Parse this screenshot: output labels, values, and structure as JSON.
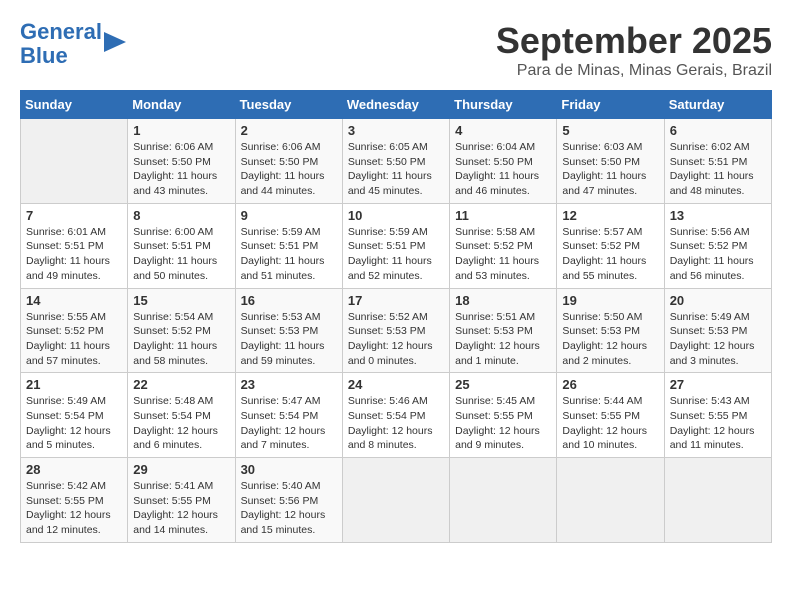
{
  "logo": {
    "line1": "General",
    "line2": "Blue"
  },
  "title": "September 2025",
  "subtitle": "Para de Minas, Minas Gerais, Brazil",
  "days_of_week": [
    "Sunday",
    "Monday",
    "Tuesday",
    "Wednesday",
    "Thursday",
    "Friday",
    "Saturday"
  ],
  "weeks": [
    [
      {
        "day": "",
        "info": ""
      },
      {
        "day": "1",
        "info": "Sunrise: 6:06 AM\nSunset: 5:50 PM\nDaylight: 11 hours\nand 43 minutes."
      },
      {
        "day": "2",
        "info": "Sunrise: 6:06 AM\nSunset: 5:50 PM\nDaylight: 11 hours\nand 44 minutes."
      },
      {
        "day": "3",
        "info": "Sunrise: 6:05 AM\nSunset: 5:50 PM\nDaylight: 11 hours\nand 45 minutes."
      },
      {
        "day": "4",
        "info": "Sunrise: 6:04 AM\nSunset: 5:50 PM\nDaylight: 11 hours\nand 46 minutes."
      },
      {
        "day": "5",
        "info": "Sunrise: 6:03 AM\nSunset: 5:50 PM\nDaylight: 11 hours\nand 47 minutes."
      },
      {
        "day": "6",
        "info": "Sunrise: 6:02 AM\nSunset: 5:51 PM\nDaylight: 11 hours\nand 48 minutes."
      }
    ],
    [
      {
        "day": "7",
        "info": "Sunrise: 6:01 AM\nSunset: 5:51 PM\nDaylight: 11 hours\nand 49 minutes."
      },
      {
        "day": "8",
        "info": "Sunrise: 6:00 AM\nSunset: 5:51 PM\nDaylight: 11 hours\nand 50 minutes."
      },
      {
        "day": "9",
        "info": "Sunrise: 5:59 AM\nSunset: 5:51 PM\nDaylight: 11 hours\nand 51 minutes."
      },
      {
        "day": "10",
        "info": "Sunrise: 5:59 AM\nSunset: 5:51 PM\nDaylight: 11 hours\nand 52 minutes."
      },
      {
        "day": "11",
        "info": "Sunrise: 5:58 AM\nSunset: 5:52 PM\nDaylight: 11 hours\nand 53 minutes."
      },
      {
        "day": "12",
        "info": "Sunrise: 5:57 AM\nSunset: 5:52 PM\nDaylight: 11 hours\nand 55 minutes."
      },
      {
        "day": "13",
        "info": "Sunrise: 5:56 AM\nSunset: 5:52 PM\nDaylight: 11 hours\nand 56 minutes."
      }
    ],
    [
      {
        "day": "14",
        "info": "Sunrise: 5:55 AM\nSunset: 5:52 PM\nDaylight: 11 hours\nand 57 minutes."
      },
      {
        "day": "15",
        "info": "Sunrise: 5:54 AM\nSunset: 5:52 PM\nDaylight: 11 hours\nand 58 minutes."
      },
      {
        "day": "16",
        "info": "Sunrise: 5:53 AM\nSunset: 5:53 PM\nDaylight: 11 hours\nand 59 minutes."
      },
      {
        "day": "17",
        "info": "Sunrise: 5:52 AM\nSunset: 5:53 PM\nDaylight: 12 hours\nand 0 minutes."
      },
      {
        "day": "18",
        "info": "Sunrise: 5:51 AM\nSunset: 5:53 PM\nDaylight: 12 hours\nand 1 minute."
      },
      {
        "day": "19",
        "info": "Sunrise: 5:50 AM\nSunset: 5:53 PM\nDaylight: 12 hours\nand 2 minutes."
      },
      {
        "day": "20",
        "info": "Sunrise: 5:49 AM\nSunset: 5:53 PM\nDaylight: 12 hours\nand 3 minutes."
      }
    ],
    [
      {
        "day": "21",
        "info": "Sunrise: 5:49 AM\nSunset: 5:54 PM\nDaylight: 12 hours\nand 5 minutes."
      },
      {
        "day": "22",
        "info": "Sunrise: 5:48 AM\nSunset: 5:54 PM\nDaylight: 12 hours\nand 6 minutes."
      },
      {
        "day": "23",
        "info": "Sunrise: 5:47 AM\nSunset: 5:54 PM\nDaylight: 12 hours\nand 7 minutes."
      },
      {
        "day": "24",
        "info": "Sunrise: 5:46 AM\nSunset: 5:54 PM\nDaylight: 12 hours\nand 8 minutes."
      },
      {
        "day": "25",
        "info": "Sunrise: 5:45 AM\nSunset: 5:55 PM\nDaylight: 12 hours\nand 9 minutes."
      },
      {
        "day": "26",
        "info": "Sunrise: 5:44 AM\nSunset: 5:55 PM\nDaylight: 12 hours\nand 10 minutes."
      },
      {
        "day": "27",
        "info": "Sunrise: 5:43 AM\nSunset: 5:55 PM\nDaylight: 12 hours\nand 11 minutes."
      }
    ],
    [
      {
        "day": "28",
        "info": "Sunrise: 5:42 AM\nSunset: 5:55 PM\nDaylight: 12 hours\nand 12 minutes."
      },
      {
        "day": "29",
        "info": "Sunrise: 5:41 AM\nSunset: 5:55 PM\nDaylight: 12 hours\nand 14 minutes."
      },
      {
        "day": "30",
        "info": "Sunrise: 5:40 AM\nSunset: 5:56 PM\nDaylight: 12 hours\nand 15 minutes."
      },
      {
        "day": "",
        "info": ""
      },
      {
        "day": "",
        "info": ""
      },
      {
        "day": "",
        "info": ""
      },
      {
        "day": "",
        "info": ""
      }
    ]
  ]
}
